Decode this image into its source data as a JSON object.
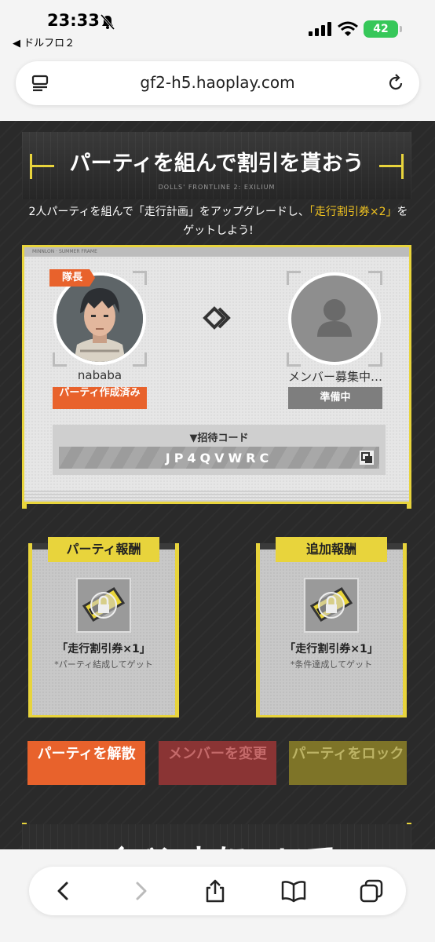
{
  "status_bar": {
    "time": "23:33",
    "back_app": "◀ ドルフロ２",
    "battery": "42"
  },
  "address_bar": {
    "url": "gf2-h5.haoplay.com"
  },
  "event": {
    "banner_title": "パーティを組んで割引を貰おう",
    "banner_subtitle": "DOLLS' FRONTLINE 2: EXILIUM",
    "description_parts": [
      "2人パーティを組んで「走行計画」をアップグレードし、",
      "「走行割引券×2」",
      "をゲットしよう!"
    ],
    "panel_strip": "MINNLON · SUMMER FRAME"
  },
  "party": {
    "leader_tag": "隊長",
    "leader_name": "nababa",
    "leader_status": "パーティ作成済み",
    "member_name": "メンバー募集中…",
    "member_status": "準備中",
    "invite_label": "▼招待コード",
    "invite_code": "JP4QVWRC"
  },
  "rewards": [
    {
      "title": "パーティ報酬",
      "item": "「走行割引券×1」",
      "note": "*パーティ結成してゲット"
    },
    {
      "title": "追加報酬",
      "item": "「走行割引券×1」",
      "note": "*条件達成してゲット"
    }
  ],
  "actions": {
    "disband": "パーティを解散",
    "change_member": "メンバーを変更",
    "lock": "パーティをロック"
  },
  "next_section_title": "イベントについて",
  "colors": {
    "accent_yellow": "#e8d43c",
    "orange": "#e8622c",
    "highlight": "#f2c420",
    "battery_green": "#36c759"
  }
}
